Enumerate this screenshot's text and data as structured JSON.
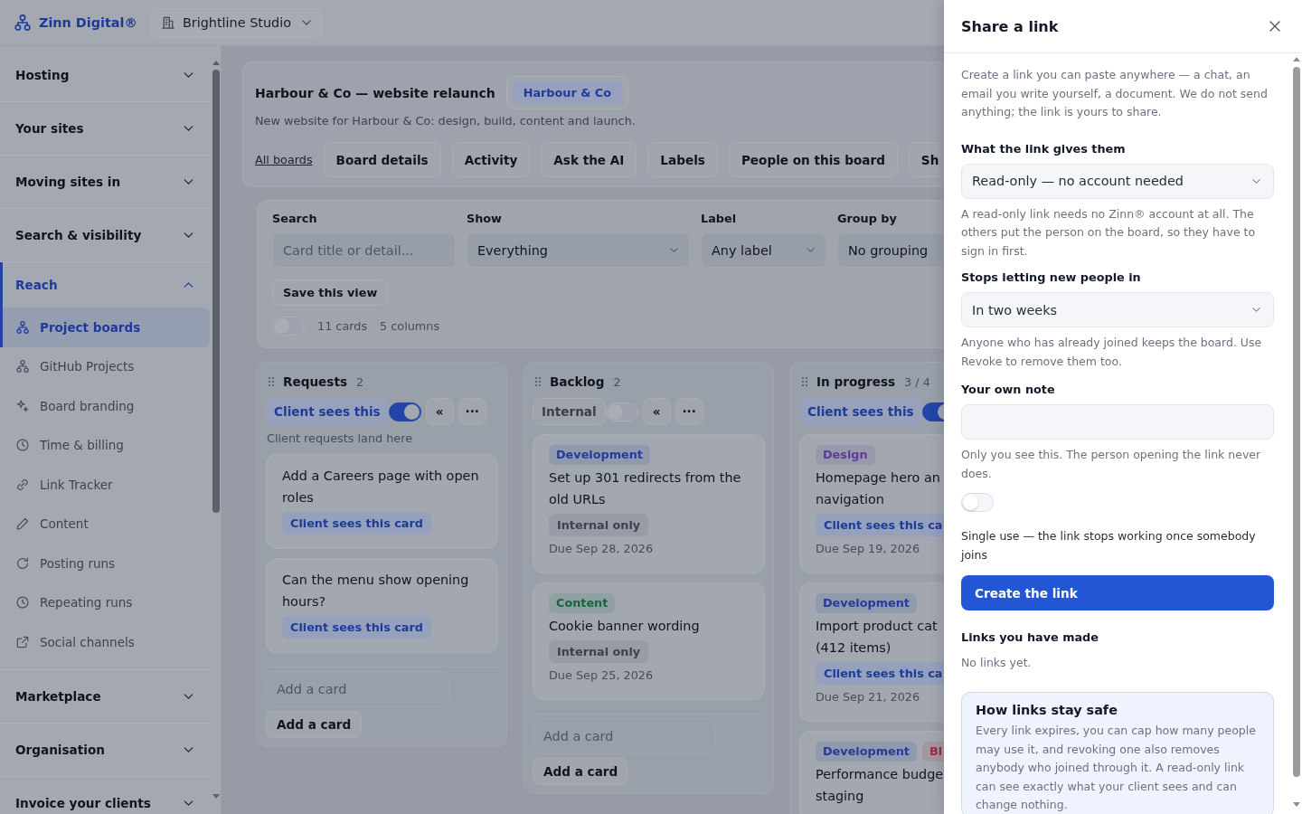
{
  "topbar": {
    "brand": "Zinn Digital®",
    "workspace": "Brightline Studio"
  },
  "sidebar": {
    "sections": [
      {
        "label": "Hosting",
        "expanded": false
      },
      {
        "label": "Your sites",
        "expanded": false
      },
      {
        "label": "Moving sites in",
        "expanded": false
      },
      {
        "label": "Search & visibility",
        "expanded": false
      },
      {
        "label": "Reach",
        "expanded": true,
        "items": [
          {
            "label": "Project boards",
            "selected": true
          },
          {
            "label": "GitHub Projects",
            "selected": false
          },
          {
            "label": "Board branding",
            "selected": false
          },
          {
            "label": "Time & billing",
            "selected": false
          },
          {
            "label": "Link Tracker",
            "selected": false
          },
          {
            "label": "Content",
            "selected": false
          },
          {
            "label": "Posting runs",
            "selected": false
          },
          {
            "label": "Repeating runs",
            "selected": false
          },
          {
            "label": "Social channels",
            "selected": false
          }
        ]
      },
      {
        "label": "Marketplace",
        "expanded": false
      },
      {
        "label": "Organisation",
        "expanded": false
      },
      {
        "label": "Invoice your clients",
        "expanded": false
      }
    ]
  },
  "board": {
    "title": "Harbour & Co — website relaunch",
    "client": "Harbour & Co",
    "description": "New website for Harbour & Co: design, build, content and launch.",
    "back_link": "All boards",
    "nav_buttons": [
      "Board details",
      "Activity",
      "Ask the AI",
      "Labels",
      "People on this board",
      "Sh"
    ]
  },
  "filters": {
    "search": {
      "label": "Search",
      "placeholder": "Card title or detail..."
    },
    "show": {
      "label": "Show",
      "value": "Everything"
    },
    "label": {
      "label": "Label",
      "value": "Any label"
    },
    "group_by": {
      "label": "Group by",
      "value": "No grouping"
    },
    "save_button": "Save this view",
    "view_toggle": {
      "on": false
    },
    "card_count": "11 cards",
    "column_count": "5 columns"
  },
  "columns": [
    {
      "title": "Requests",
      "count": "2",
      "visibility": {
        "text": "Client sees this",
        "client_visible": true
      },
      "collapse_button": "«",
      "more_button": "···",
      "note": "Client requests land here",
      "cards": [
        {
          "title": "Add a Careers page with open roles",
          "visibility_tag": {
            "text": "Client sees this card",
            "client_visible": true
          }
        },
        {
          "title": "Can the menu show opening hours?",
          "visibility_tag": {
            "text": "Client sees this card",
            "client_visible": true
          }
        }
      ],
      "add_field": {
        "placeholder": "Add a card"
      },
      "add_button": "Add a card"
    },
    {
      "title": "Backlog",
      "count": "2",
      "visibility": {
        "text": "Internal",
        "client_visible": false
      },
      "collapse_button": "«",
      "more_button": "···",
      "cards": [
        {
          "labels": [
            {
              "text": "Development",
              "color": "#233c9c"
            }
          ],
          "title": "Set up 301 redirects from the old URLs",
          "visibility_tag": {
            "text": "Internal only",
            "client_visible": false
          },
          "due": "Due Sep 28, 2026"
        },
        {
          "labels": [
            {
              "text": "Content",
              "color": "#17663e"
            }
          ],
          "title": "Cookie banner wording",
          "visibility_tag": {
            "text": "Internal only",
            "client_visible": false
          },
          "due": "Due Sep 25, 2026"
        }
      ],
      "add_field": {
        "placeholder": "Add a card"
      },
      "add_button": "Add a card"
    },
    {
      "title": "In progress",
      "count": "3 / 4",
      "visibility": {
        "text": "Client sees this",
        "client_visible": true
      },
      "cards": [
        {
          "labels": [
            {
              "text": "Design",
              "color": "#5b3b99"
            }
          ],
          "title": "Homepage hero an\nnavigation",
          "visibility_tag": {
            "text": "Client sees this ca",
            "client_visible": true
          },
          "due": "Due Sep 19, 2026"
        },
        {
          "labels": [
            {
              "text": "Development",
              "color": "#233c9c"
            }
          ],
          "title": "Import product cat\n(412 items)",
          "visibility_tag": {
            "text": "Client sees this ca",
            "client_visible": true
          },
          "due": "Due Sep 21, 2026"
        },
        {
          "labels": [
            {
              "text": "Development",
              "color": "#233c9c"
            },
            {
              "text": "Bl",
              "color": "#a22b37"
            }
          ],
          "title": "Performance budge\nstaging"
        }
      ]
    }
  ],
  "share_panel": {
    "title": "Share a link",
    "intro": "Create a link you can paste anywhere — a chat, an email you write yourself, a document. We do not send anything; the link is yours to share.",
    "access": {
      "label": "What the link gives them",
      "value": "Read-only — no account needed",
      "help": "A read-only link needs no Zinn® account at all. The others put the person on the board, so they have to sign in first."
    },
    "expiry": {
      "label": "Stops letting new people in",
      "value": "In two weeks",
      "help": "Anyone who has already joined keeps the board. Use Revoke to remove them too."
    },
    "note": {
      "label": "Your own note",
      "help": "Only you see this. The person opening the link never does."
    },
    "single_use": {
      "on": false,
      "label": "Single use — the link stops working once somebody joins"
    },
    "create_button": "Create the link",
    "links_heading": "Links you have made",
    "links_empty": "No links yet.",
    "info": {
      "title": "How links stay safe",
      "text": "Every link expires, you can cap how many people may use it, and revoking one also removes anybody who joined through it. A read-only link can see exactly what your client sees and can change nothing."
    }
  }
}
